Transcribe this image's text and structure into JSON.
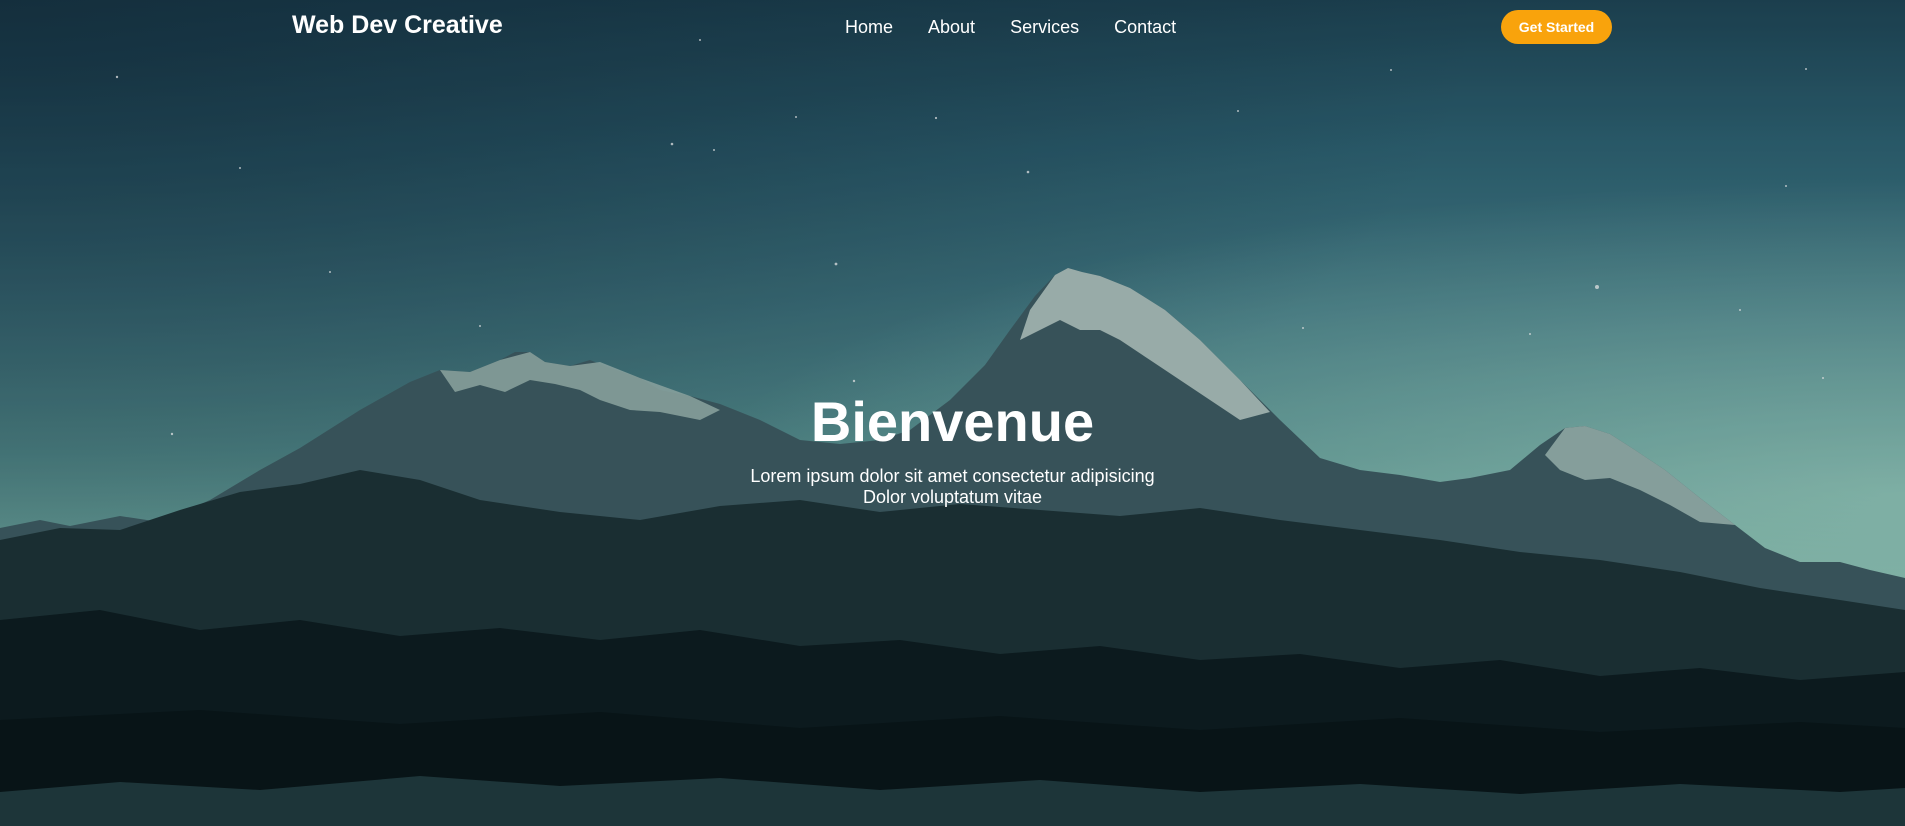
{
  "header": {
    "logo": "Web Dev Creative",
    "nav": [
      {
        "label": "Home"
      },
      {
        "label": "About"
      },
      {
        "label": "Services"
      },
      {
        "label": "Contact"
      }
    ],
    "cta_label": "Get Started"
  },
  "hero": {
    "title": "Bienvenue",
    "line1": "Lorem ipsum dolor sit amet consectetur adipisicing",
    "line2": "Dolor voluptatum vitae"
  },
  "colors": {
    "accent": "#f9a30c",
    "text": "#ffffff"
  },
  "background_image": "mountain-range-at-dusk"
}
